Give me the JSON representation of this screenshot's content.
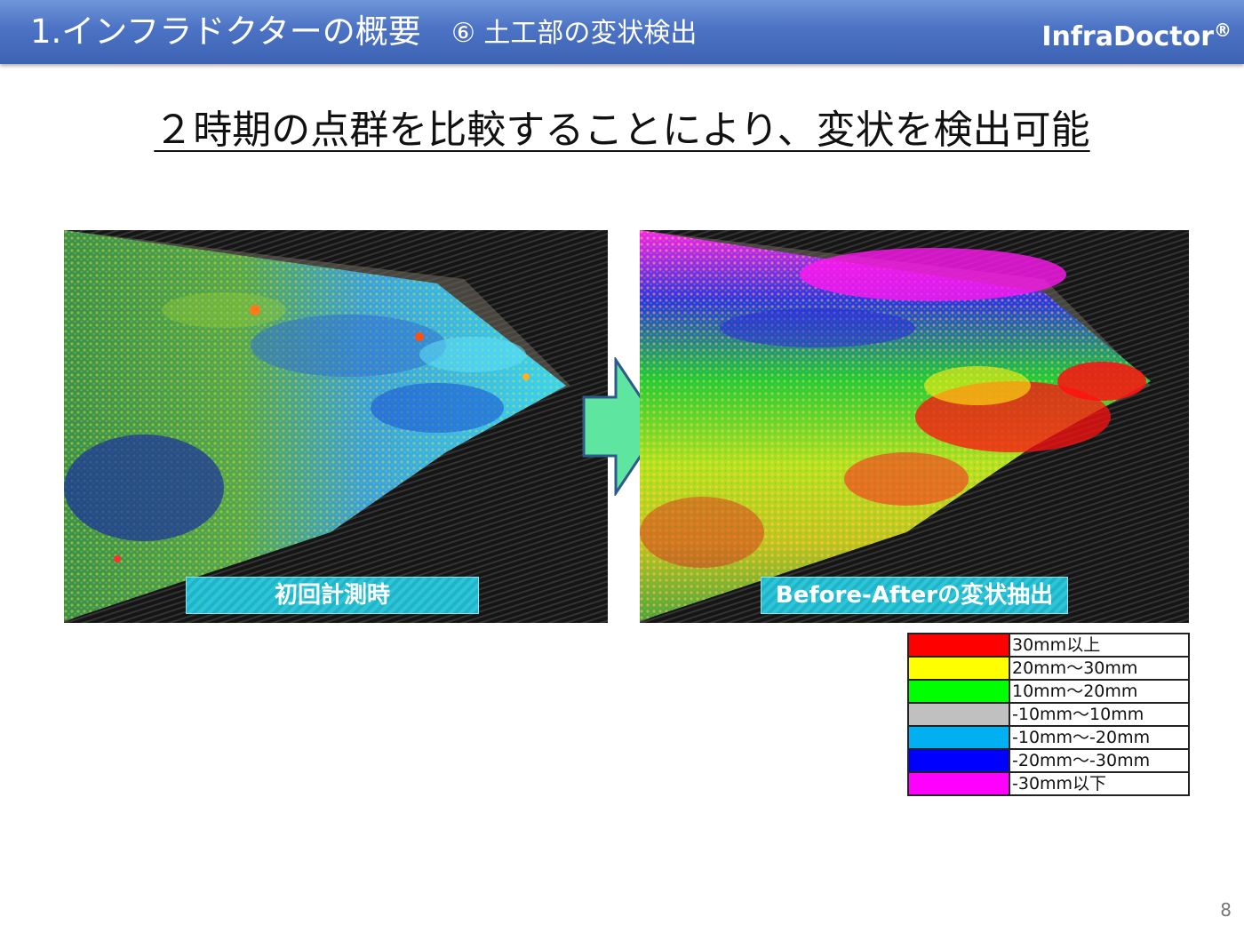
{
  "header": {
    "title": "1.インフラドクターの概要",
    "subtitle": "⑥ 土工部の変状検出",
    "brand": "InfraDoctor",
    "brand_mark": "®"
  },
  "headline": "２時期の点群を比較することにより、変状を検出可能",
  "panels": {
    "before_label": "初回計測時",
    "after_label": "Before-Afterの変状抽出"
  },
  "legend": [
    {
      "color": "#ff0000",
      "label": "30mm以上"
    },
    {
      "color": "#ffff00",
      "label": "20mm～30mm"
    },
    {
      "color": "#00ff00",
      "label": "10mm～20mm"
    },
    {
      "color": "#c0c0c0",
      "label": " -10mm～10mm"
    },
    {
      "color": "#00b0f0",
      "label": " -10mm～-20mm"
    },
    {
      "color": "#0000ff",
      "label": " -20mm～-30mm"
    },
    {
      "color": "#ff00ff",
      "label": " -30mm以下"
    }
  ],
  "page_number": "8"
}
